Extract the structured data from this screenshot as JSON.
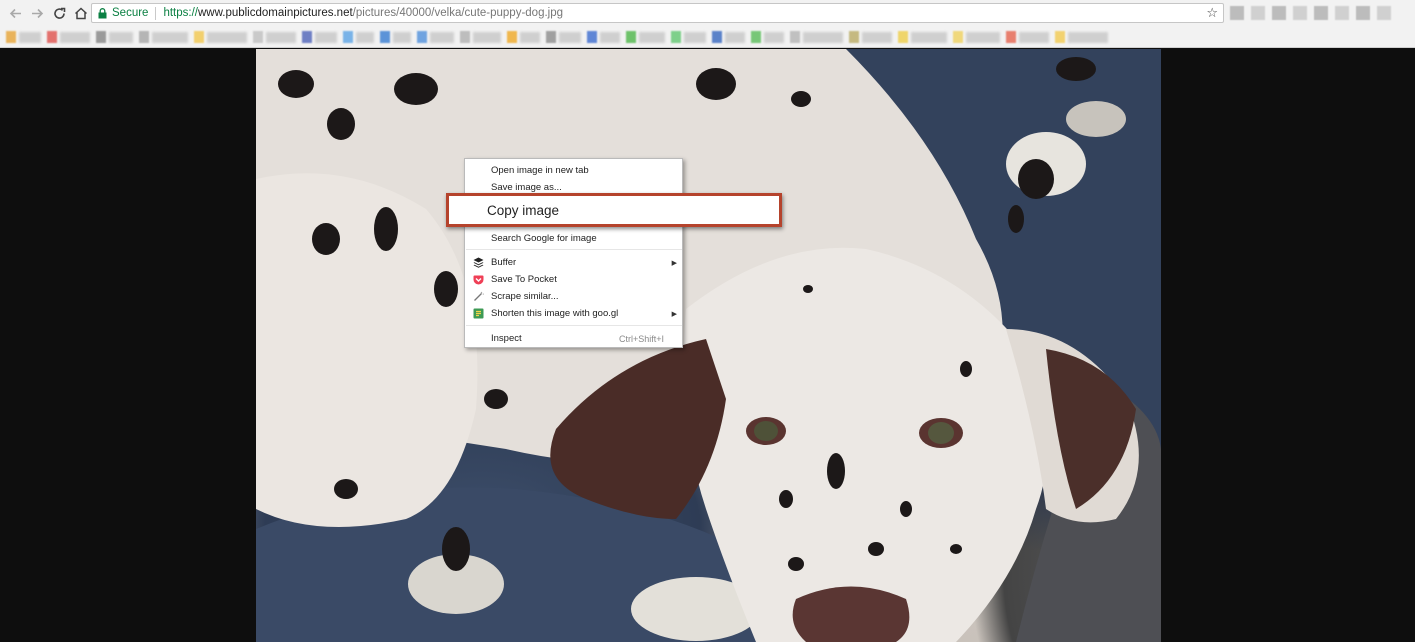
{
  "toolbar": {
    "back_icon": "back-arrow-icon",
    "forward_icon": "forward-arrow-icon",
    "reload_icon": "reload-icon",
    "home_icon": "home-icon"
  },
  "omnibox": {
    "secure_label": "Secure",
    "url_scheme": "https://",
    "url_host": "www.publicdomainpictures.net",
    "url_path": "/pictures/40000/velka/cute-puppy-dog.jpg",
    "bookmark_star_icon": "star-icon"
  },
  "colors": {
    "secure_green": "#0b8043",
    "highlight_border": "#b5432c",
    "pocket_red": "#ef3f56"
  },
  "context_menu": {
    "open_new_tab": "Open image in new tab",
    "save_as": "Save image as...",
    "copy_image": "Copy image",
    "search_google": "Search Google for image",
    "buffer": "Buffer",
    "save_to_pocket": "Save To Pocket",
    "scrape_similar": "Scrape similar...",
    "shorten_goo_gl": "Shorten this image with goo.gl",
    "inspect": "Inspect",
    "inspect_shortcut": "Ctrl+Shift+I"
  }
}
